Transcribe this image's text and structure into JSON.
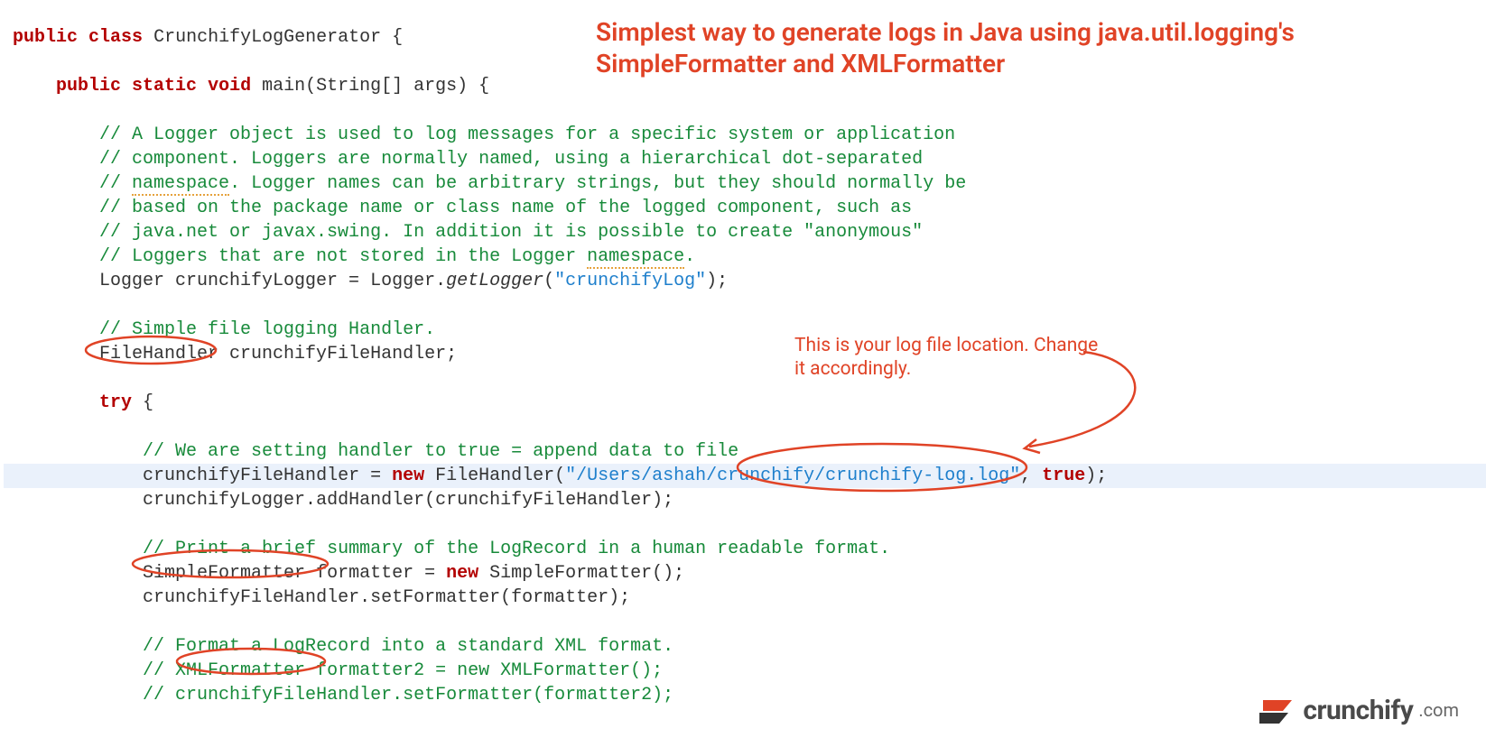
{
  "title": "Simplest way to generate logs in Java using java.util.logging's SimpleFormatter and XMLFormatter",
  "note": "This is your log file location. Change it accordingly.",
  "logo_brand": "crunchify",
  "logo_tld": ".com",
  "code": {
    "l1_kw_public": "public",
    "l1_kw_class": "class",
    "l1_name": "CrunchifyLogGenerator",
    "l1_brace": " {",
    "main_kw_public": "public",
    "main_kw_static": "static",
    "main_kw_void": "void",
    "main_name": "main",
    "main_args_open": "(String[] ",
    "main_args_name": "args",
    "main_args_close": ") {",
    "c1": "// A Logger object is used to log messages for a specific system or application",
    "c2a": "// component. Loggers are normally named, using a hierarchical dot-separated",
    "c3a": "// ",
    "c3_ns": "namespace",
    "c3b": ". Logger names can be arbitrary strings, but they should normally be",
    "c4": "// based on the package name or class name of the logged component, such as",
    "c5": "// java.net or javax.swing. In addition it is possible to create \"anonymous\"",
    "c6a": "// Loggers that are not stored in the Logger ",
    "c6_ns": "namespace",
    "c6b": ".",
    "loggerDecl_a": "Logger crunchifyLogger = Logger.",
    "loggerDecl_method": "getLogger",
    "loggerDecl_open": "(",
    "loggerDecl_str": "\"crunchifyLog\"",
    "loggerDecl_close": ");",
    "c_fh": "// Simple file logging Handler.",
    "fh_decl": "FileHandler crunchifyFileHandler;",
    "try_kw": "try",
    "try_brace": " {",
    "c_append": "// We are setting handler to true = append data to file",
    "fhnew_a": "crunchifyFileHandler = ",
    "fhnew_new": "new",
    "fhnew_b": " FileHandler(",
    "fhnew_str": "\"/Users/ashah/crunchify/crunchify-log.log\"",
    "fhnew_c": ", ",
    "fhnew_true": "true",
    "fhnew_d": ");",
    "addHandler": "crunchifyLogger.addHandler(crunchifyFileHandler);",
    "c_brief": "// Print a brief summary of the LogRecord in a human readable format.",
    "sf_a": "SimpleFormatter formatter = ",
    "sf_new": "new",
    "sf_b": " SimpleFormatter();",
    "setFmt": "crunchifyFileHandler.setFormatter(formatter);",
    "c_xml": "// Format a LogRecord into a standard XML format.",
    "c_xmlf": "// XMLFormatter formatter2 = new XMLFormatter();",
    "c_setf2": "// crunchifyFileHandler.setFormatter(formatter2);"
  }
}
